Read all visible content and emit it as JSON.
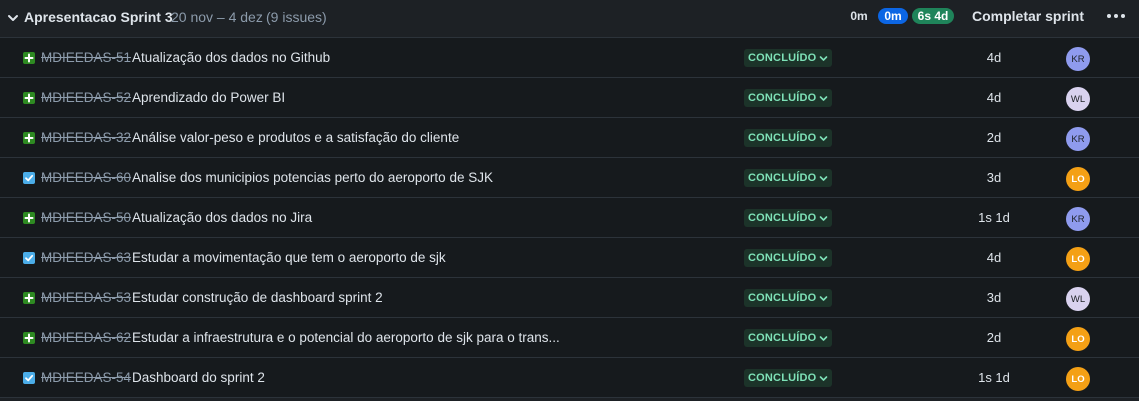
{
  "sprint": {
    "title": "Apresentacao Sprint 3",
    "dates": "20 nov – 4 dez",
    "issue_count": "(9 issues)",
    "stats": {
      "todo": "0m",
      "in_progress": "0m",
      "done": "6s 4d"
    },
    "complete_label": "Completar sprint",
    "more_icon": "more-horizontal-icon"
  },
  "colors": {
    "story": "#2e8b22",
    "task": "#4bade8",
    "in_progress": "#0c66e4",
    "done": "#1f845a",
    "status_text": "#7ee2b8"
  },
  "issues": [
    {
      "type": "story",
      "key": "MDIEEDAS-51",
      "summary": "Atualização dos dados no Github",
      "status": "CONCLUÍDO",
      "estimate": "4d",
      "assignee": "KR"
    },
    {
      "type": "story",
      "key": "MDIEEDAS-52",
      "summary": "Aprendizado do Power BI",
      "status": "CONCLUÍDO",
      "estimate": "4d",
      "assignee": "WL"
    },
    {
      "type": "story",
      "key": "MDIEEDAS-32",
      "summary": "Análise valor-peso e produtos e a satisfação do cliente",
      "status": "CONCLUÍDO",
      "estimate": "2d",
      "assignee": "KR"
    },
    {
      "type": "task",
      "key": "MDIEEDAS-60",
      "summary": "Analise dos municipios potencias perto do aeroporto de SJK",
      "status": "CONCLUÍDO",
      "estimate": "3d",
      "assignee": "LO"
    },
    {
      "type": "story",
      "key": "MDIEEDAS-50",
      "summary": "Atualização dos dados no Jira",
      "status": "CONCLUÍDO",
      "estimate": "1s 1d",
      "assignee": "KR"
    },
    {
      "type": "task",
      "key": "MDIEEDAS-63",
      "summary": "Estudar a movimentação que tem o aeroporto de sjk",
      "status": "CONCLUÍDO",
      "estimate": "4d",
      "assignee": "LO"
    },
    {
      "type": "story",
      "key": "MDIEEDAS-53",
      "summary": "Estudar construção de dashboard sprint 2",
      "status": "CONCLUÍDO",
      "estimate": "3d",
      "assignee": "WL"
    },
    {
      "type": "story",
      "key": "MDIEEDAS-62",
      "summary": "Estudar a infraestrutura e o potencial do aeroporto de sjk para o trans...",
      "status": "CONCLUÍDO",
      "estimate": "2d",
      "assignee": "LO"
    },
    {
      "type": "task",
      "key": "MDIEEDAS-54",
      "summary": "Dashboard do sprint 2",
      "status": "CONCLUÍDO",
      "estimate": "1s 1d",
      "assignee": "LO"
    }
  ]
}
